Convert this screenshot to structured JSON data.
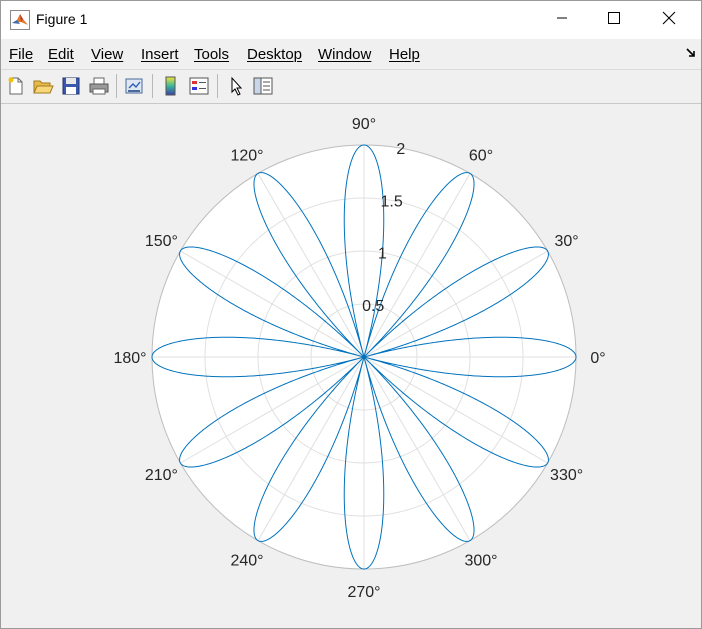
{
  "window": {
    "title": "Figure 1",
    "app_icon": "matlab-icon",
    "controls": {
      "minimize": "minimize-icon",
      "maximize": "maximize-icon",
      "close": "close-icon"
    }
  },
  "menu": {
    "items": [
      {
        "label": "File",
        "name": "menu-file"
      },
      {
        "label": "Edit",
        "name": "menu-edit"
      },
      {
        "label": "View",
        "name": "menu-view"
      },
      {
        "label": "Insert",
        "name": "menu-insert"
      },
      {
        "label": "Tools",
        "name": "menu-tools"
      },
      {
        "label": "Desktop",
        "name": "menu-desktop"
      },
      {
        "label": "Window",
        "name": "menu-window"
      },
      {
        "label": "Help",
        "name": "menu-help"
      }
    ],
    "dock_icon": "dock-arrow-icon"
  },
  "toolbar": {
    "buttons": [
      {
        "icon": "new-figure-icon"
      },
      {
        "icon": "open-file-icon"
      },
      {
        "icon": "save-icon"
      },
      {
        "icon": "print-icon"
      },
      {
        "icon": "link-plot-icon"
      },
      {
        "icon": "insert-colorbar-icon"
      },
      {
        "icon": "insert-legend-icon"
      },
      {
        "icon": "pointer-icon"
      },
      {
        "icon": "property-inspector-icon"
      }
    ]
  },
  "colors": {
    "curve": "#0072bd",
    "grid": "#e0e0e0",
    "axis_text": "#262626",
    "axes_background": "#ffffff",
    "figure_background": "#f0f0f0"
  },
  "chart_data": {
    "type": "line",
    "coordinate_system": "polar",
    "series": [
      {
        "expression": "r = 2*cos(6*theta)",
        "theta_range_deg": [
          0,
          360
        ],
        "petals": 12,
        "r_max": 2
      }
    ],
    "theta_ticks": [
      "0°",
      "30°",
      "60°",
      "90°",
      "120°",
      "150°",
      "180°",
      "210°",
      "240°",
      "270°",
      "300°",
      "330°"
    ],
    "theta_tick_values": [
      0,
      30,
      60,
      90,
      120,
      150,
      180,
      210,
      240,
      270,
      300,
      330
    ],
    "r_ticks": [
      "0.5",
      "1",
      "1.5",
      "2"
    ],
    "r_tick_values": [
      0.5,
      1,
      1.5,
      2
    ],
    "rlim": [
      0,
      2
    ],
    "grid": true,
    "title": "",
    "legend": false
  }
}
